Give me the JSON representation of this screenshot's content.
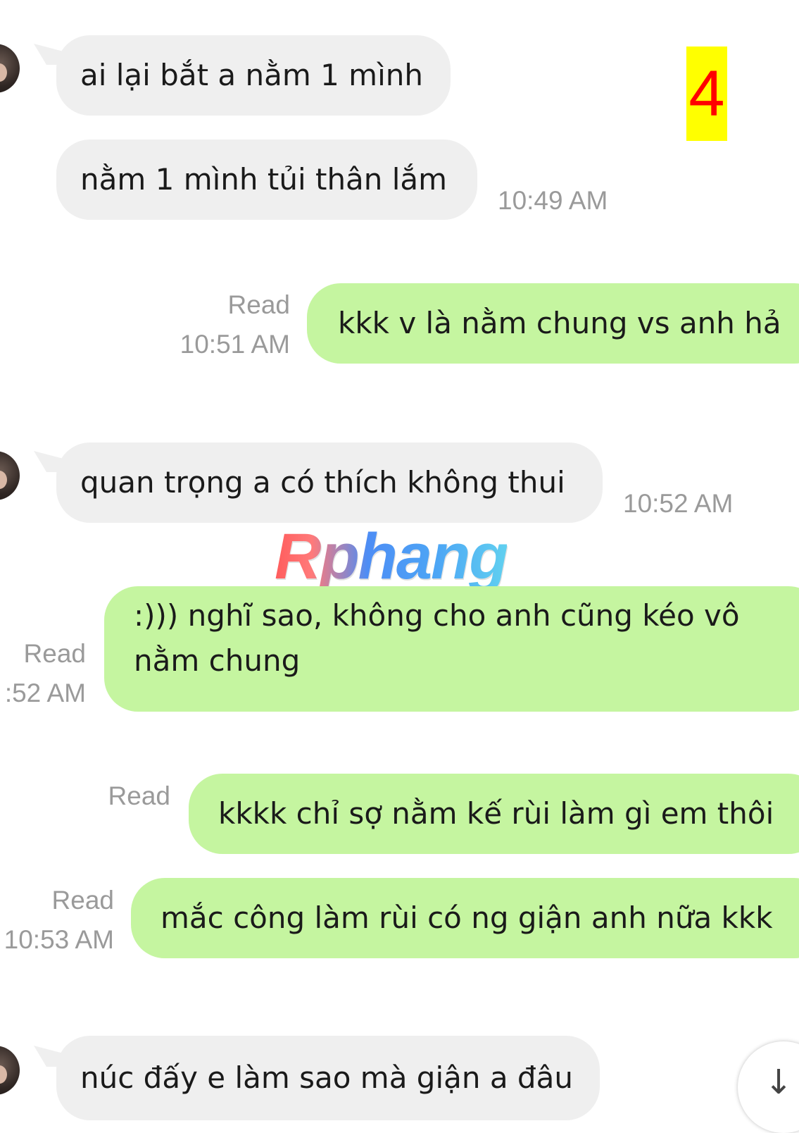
{
  "badge": {
    "number": "4",
    "background": "#ffff00",
    "color": "#ff0000"
  },
  "watermark": {
    "text": "Rphang"
  },
  "colors": {
    "incoming_bubble": "#efefef",
    "outgoing_bubble": "#c5f5a0",
    "meta_text": "#9a9a9a"
  },
  "messages": [
    {
      "direction": "incoming",
      "text": "ai lại bắt a nằm 1 mình"
    },
    {
      "direction": "incoming",
      "text": "nằm 1 mình tủi thân lắm",
      "time": "10:49 AM"
    },
    {
      "direction": "outgoing",
      "text": "kkk v là nằm chung vs anh hả",
      "status": "Read",
      "time": "10:51 AM"
    },
    {
      "direction": "incoming",
      "text": "quan trọng a có thích không thui",
      "time": "10:52 AM"
    },
    {
      "direction": "outgoing",
      "text": ":))) nghĩ sao, không cho anh cũng kéo vô nằm chung",
      "status": "Read",
      "time": ":52 AM"
    },
    {
      "direction": "outgoing",
      "text": "kkkk chỉ sợ nằm kế rùi làm gì em thôi",
      "status": "Read"
    },
    {
      "direction": "outgoing",
      "text": "mắc công làm rùi có ng giận anh nữa kkk",
      "status": "Read",
      "time": "10:53 AM"
    },
    {
      "direction": "incoming",
      "text": "núc đấy e làm sao mà giận a đâu"
    }
  ],
  "scroll_button": {
    "icon": "arrow-down-icon"
  }
}
